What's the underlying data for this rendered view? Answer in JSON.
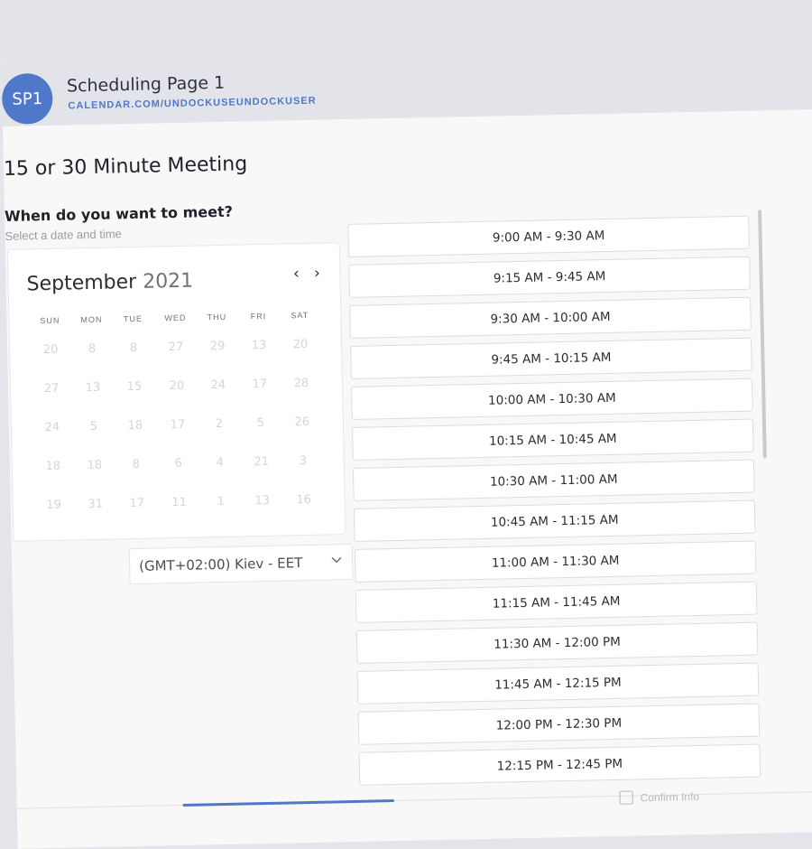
{
  "header": {
    "avatar_initials": "SP1",
    "title": "Scheduling Page 1",
    "url": "CALENDAR.COM/UNDOCKUSEUNDOCKUSER"
  },
  "meeting": {
    "title": "15 or 30 Minute Meeting",
    "question": "When do you want to meet?",
    "subtitle": "Select a date and time"
  },
  "calendar": {
    "month": "September",
    "year": "2021",
    "prev_icon": "‹",
    "next_icon": "›",
    "weekdays": [
      "SUN",
      "MON",
      "TUE",
      "WED",
      "THU",
      "FRI",
      "SAT"
    ],
    "weeks": [
      [
        "20",
        "8",
        "8",
        "27",
        "29",
        "13",
        "20"
      ],
      [
        "27",
        "13",
        "15",
        "20",
        "24",
        "17",
        "28"
      ],
      [
        "24",
        "5",
        "18",
        "17",
        "2",
        "5",
        "26"
      ],
      [
        "18",
        "18",
        "8",
        "6",
        "4",
        "21",
        "3"
      ],
      [
        "19",
        "31",
        "17",
        "11",
        "1",
        "13",
        "16"
      ]
    ]
  },
  "timezone": {
    "value": "(GMT+02:00) Kiev - EET"
  },
  "slots": [
    "9:00 AM - 9:30 AM",
    "9:15 AM - 9:45 AM",
    "9:30 AM - 10:00 AM",
    "9:45 AM - 10:15 AM",
    "10:00 AM - 10:30 AM",
    "10:15 AM - 10:45 AM",
    "10:30 AM - 11:00 AM",
    "10:45 AM - 11:15 AM",
    "11:00 AM - 11:30 AM",
    "11:15 AM - 11:45 AM",
    "11:30 AM - 12:00 PM",
    "11:45 AM - 12:15 PM",
    "12:00 PM - 12:30 PM",
    "12:15 PM - 12:45 PM"
  ],
  "footer": {
    "confirm_label": "Confirm Info"
  },
  "colors": {
    "accent": "#4f78c9",
    "background": "#e4e5ea",
    "panel": "#f8f8f9"
  }
}
